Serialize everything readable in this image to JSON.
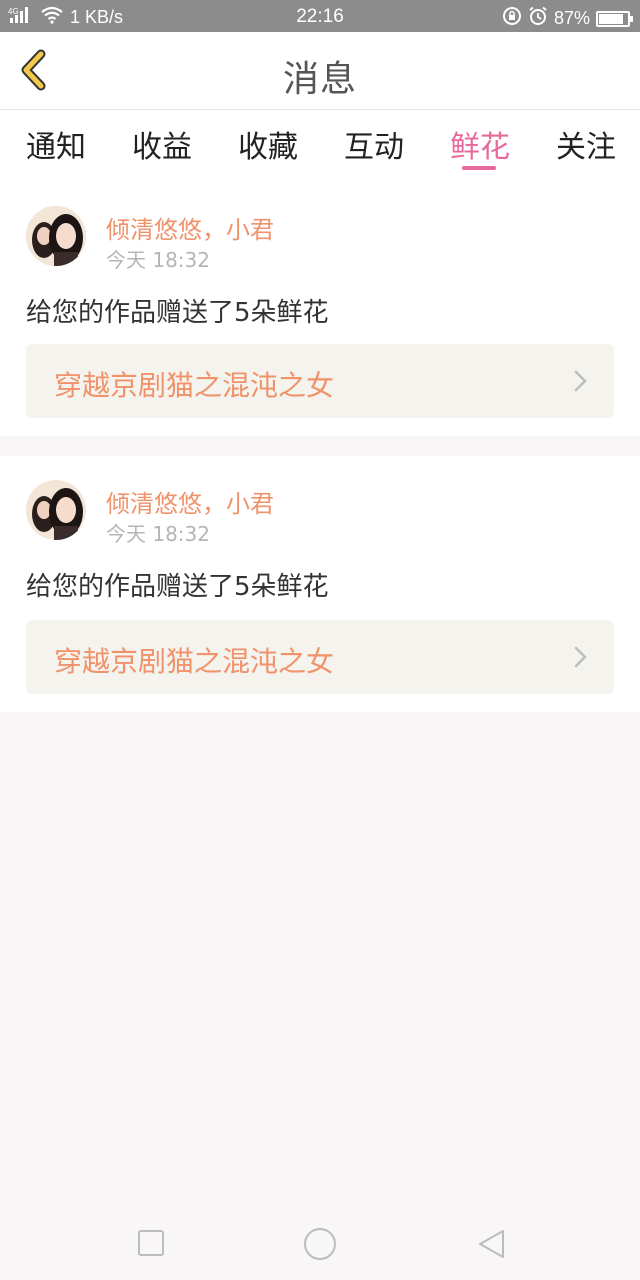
{
  "status_bar": {
    "network": "4G",
    "speed": "1 KB/s",
    "time": "22:16",
    "battery": "87%",
    "battery_level": 0.87
  },
  "header": {
    "title": "消息"
  },
  "tabs": [
    {
      "label": "通知",
      "active": false
    },
    {
      "label": "收益",
      "active": false
    },
    {
      "label": "收藏",
      "active": false
    },
    {
      "label": "互动",
      "active": false
    },
    {
      "label": "鲜花",
      "active": true
    },
    {
      "label": "关注",
      "active": false
    }
  ],
  "messages": [
    {
      "user": "倾清悠悠，小君",
      "time": "今天 18:32",
      "text": "给您的作品赠送了5朵鲜花",
      "work_title": "穿越京剧猫之混沌之女"
    },
    {
      "user": "倾清悠悠，小君",
      "time": "今天 18:32",
      "text": "给您的作品赠送了5朵鲜花",
      "work_title": "穿越京剧猫之混沌之女"
    }
  ],
  "colors": {
    "accent": "#e8699b",
    "username": "#f0926a",
    "link_bg": "#f4f3ee",
    "back_icon": "#f2c94c"
  },
  "icons": {
    "back": "chevron-left-icon",
    "wifi": "wifi-icon",
    "signal": "signal-icon",
    "alarm": "alarm-icon",
    "rotation_lock": "rotation-lock-icon",
    "work_chevron": "chevron-right-icon",
    "nav_recent": "square-icon",
    "nav_home": "circle-icon",
    "nav_back": "triangle-back-icon"
  }
}
